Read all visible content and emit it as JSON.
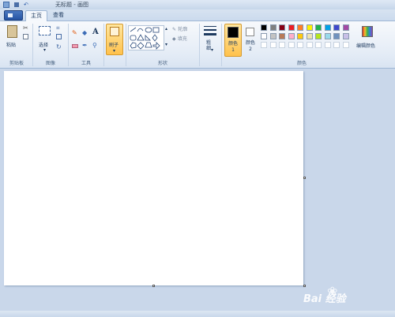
{
  "window": {
    "title": "无标题 - 画图"
  },
  "tabs": [
    {
      "label": "主页"
    },
    {
      "label": "查看"
    }
  ],
  "ribbon": {
    "clipboard": {
      "paste_label": "粘贴",
      "group_label": "剪贴板"
    },
    "image": {
      "select_label": "选择",
      "group_label": "图像"
    },
    "tools": {
      "group_label": "工具"
    },
    "brushes": {
      "label": "刷子"
    },
    "shapes": {
      "outline_label": "轮廓",
      "fill_label": "填充",
      "group_label": "形状"
    },
    "size": {
      "label": "粗细"
    },
    "colors": {
      "color1_label": "颜色 1",
      "color2_label": "颜色 2",
      "edit_colors_label": "编辑颜色",
      "group_label": "颜色",
      "color1_value": "#000000",
      "color2_value": "#ffffff",
      "palette": [
        "#000000",
        "#7f7f7f",
        "#880015",
        "#ed1c24",
        "#ff7f27",
        "#fff200",
        "#22b14c",
        "#00a2e8",
        "#3f48cc",
        "#a349a4",
        "#ffffff",
        "#c3c3c3",
        "#b97a57",
        "#ffaec9",
        "#ffc90e",
        "#efe4b0",
        "#b5e61d",
        "#99d9ea",
        "#7092be",
        "#c8bfe7"
      ]
    }
  },
  "watermark": {
    "text": "Bai 经验"
  }
}
